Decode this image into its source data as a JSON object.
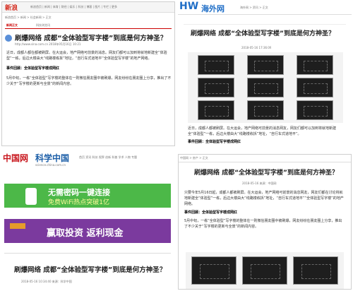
{
  "colors": {
    "sina_red": "#d52b1e",
    "hww_blue": "#1f6ec7",
    "science_red": "#c8161d",
    "wifi_green": "#3aa53a",
    "fund_purple": "#6a2c8e",
    "nav_blue": "#1d5fa8"
  },
  "sina": {
    "logo": "新浪",
    "nav": "新浪首页 | 新闻 | 体育 | 财经 | 娱乐 | 科技 | 博客 | 图片 | 专栏 | 更多",
    "breadcrumb": "新浪首页 > 新闻 > 社会新闻 > 正文",
    "tabs": [
      "新闻正文",
      "科技浏览讯"
    ],
    "title": "刷爆网络 成都“全体验型写字楼”到底是何方神圣？",
    "meta": "http://www.sina.com.cn  2018年05月16日 10:21",
    "p1": "近日，成都人都在都被刷屏。在大运会，地产网络可前景的消息。网友们都可以加到将就地新建全“体验型”一栋，后边大楼由大“线路楼栋拆”地址，“自行车式道地平“全体验型写字楼”的地产网络。",
    "p2": "事件回顾：全体验型写字楼成网红",
    "p3": "5月中旬，一栋“全体验型”写字楼的整体在一则微信朋友圈中被刷爆，网友纷纷在朋友圈上分享，推出了不少关于“写字楼的更新与全景”的新闻内容。"
  },
  "hww": {
    "logo_mark": "HW",
    "logo": "海外网",
    "breadcrumb": "海外网 > 资讯 > 正文",
    "title": "刷爆网络 成都“全体验型写字楼”到底是何方神圣？",
    "meta": "2018-05-16 17:36:09",
    "p1": "近日，成都人都被刷屏。在大运会，地产网络可前景的消息网友，网友们都可以加到将就地新建全“体验型”一栋，后边大楼由大“线路楼栋拆”地址，“自行车式道地平”。",
    "p2": "事件回顾：全体验型写字楼成网红"
  },
  "science": {
    "logo_cn": "中国网",
    "logo_sci": "科学中国",
    "url": "science.china.com.cn",
    "nav": "首页 资讯 科技 视界 创新 科普 学术 人物 专题",
    "banner1_title": "无需密码一键连接",
    "banner1_sub": "免费WiFi热点突破1亿",
    "banner2_text": "赢取投资 返利现金",
    "title": "刷爆网络 成都“全体验型写字楼”到底是何方神圣？",
    "meta": "2018-05-16 10:34:40  来源：科学中国"
  },
  "china": {
    "breadcrumb": "中国网 > 房产 > 正文",
    "title": "刷爆网络 成都“全体验型写字楼”到底是何方神圣？",
    "meta": "2018-05-16  来源：中国网",
    "p1": "只要今年5月16日起，成都人都被刷屏。在大运会，地产网络可前景的消息网友，网友们都在讨论将就地新建全“体验型”一栋，后边大楼由大“线路楼栋拆”地址，“自行车式道地平”“全体验型写字楼”的地产网络。",
    "p2": "事件回顾：全体验型写字楼成网红",
    "p3": "5月中旬，一栋“全体验型”写字楼的整体在一则微信朋友圈中被刷爆，网友纷纷在朋友圈上分享，推出了不少关于“写字楼的更新与全景”的新闻内容。"
  }
}
